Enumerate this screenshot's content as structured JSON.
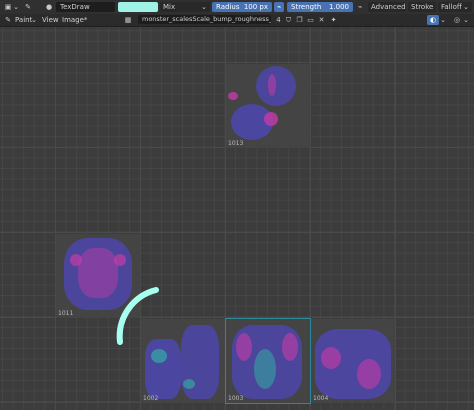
{
  "toolbar": {
    "brush_name": "TexDraw",
    "brush_color": "#9ff3e6",
    "blend_mode": "Mix",
    "radius_label": "Radius",
    "radius_value": "100 px",
    "strength_label": "Strength",
    "strength_value": "1.000",
    "advanced_label": "Advanced",
    "stroke_label": "Stroke",
    "falloff_label": "Falloff"
  },
  "header": {
    "mode_label": "Paint",
    "view_label": "View",
    "image_label": "Image*",
    "image_name": "monster_scalesScale_bump_roughness_1002.png",
    "user_count": "4"
  },
  "tiles": [
    {
      "id": "1013"
    },
    {
      "id": "1011"
    },
    {
      "id": "1002"
    },
    {
      "id": "1003"
    },
    {
      "id": "1004"
    }
  ],
  "colors": {
    "accent_blue": "#4772b3",
    "texture_violet": "#4e47b8",
    "texture_magenta": "#c63aa8",
    "cursor_cyan": "#a8fff0"
  }
}
